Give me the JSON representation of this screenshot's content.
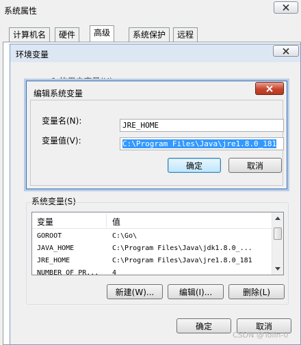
{
  "sysprops": {
    "title": "系统属性",
    "close_icon": "close-icon",
    "tabs": [
      {
        "label": "计算机名",
        "active": false
      },
      {
        "label": "硬件",
        "active": false
      },
      {
        "label": "高级",
        "active": true
      },
      {
        "label": "系统保护",
        "active": false
      },
      {
        "label": "远程",
        "active": false
      }
    ]
  },
  "env_dialog": {
    "title": "环境变量",
    "close_icon": "close-icon",
    "user_section_partial": "1 的用户变量(U)",
    "system_vars": {
      "label": "系统变量(S)",
      "columns": [
        "变量",
        "值"
      ],
      "rows": [
        {
          "name": "GOROOT",
          "value": "C:\\Go\\"
        },
        {
          "name": "JAVA_HOME",
          "value": "C:\\Program Files\\Java\\jdk1.8.0_..."
        },
        {
          "name": "JRE_HOME",
          "value": "C:\\Program Files\\Java\\jre1.8.0_181"
        },
        {
          "name": "NUMBER_OF_PR...",
          "value": "4"
        }
      ]
    },
    "buttons": {
      "new": "新建(W)...",
      "edit": "编辑(I)...",
      "delete": "删除(L)"
    },
    "ok": "确定",
    "cancel": "取消"
  },
  "edit_dialog": {
    "title": "编辑系统变量",
    "close_icon": "close-icon",
    "name_label": "变量名(N):",
    "name_value": "JRE_HOME",
    "value_label": "变量值(V):",
    "value_value": "C:\\Program Files\\Java\\jre1.8.0_181",
    "ok": "确定",
    "cancel": "取消"
  },
  "watermark": "CSDN @Tolin-0",
  "colors": {
    "selection": "#3399ff",
    "close_red": "#c7462c",
    "default_button": "#bee6fd"
  }
}
